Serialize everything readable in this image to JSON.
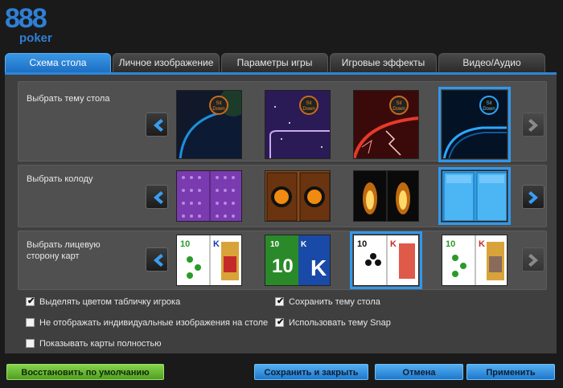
{
  "brand": {
    "logo_top": "888",
    "logo_bottom": "poker"
  },
  "tabs": [
    {
      "label": "Схема стола",
      "active": true
    },
    {
      "label": "Личное изображение",
      "active": false
    },
    {
      "label": "Параметры игры",
      "active": false
    },
    {
      "label": "Игровые эффекты",
      "active": false
    },
    {
      "label": "Видео/Аудио",
      "active": false
    }
  ],
  "sections": {
    "table_theme": {
      "label": "Выбрать тему стола",
      "sit_down": "Sit Down",
      "selected_index": 3,
      "left_arrow_icon": "chevron-left-icon",
      "right_arrow_icon": "chevron-right-icon",
      "right_arrow_enabled": false
    },
    "deck": {
      "label": "Выбрать колоду",
      "selected_index": 3,
      "right_arrow_enabled": true
    },
    "card_face": {
      "label_line1": "Выбрать лицевую",
      "label_line2": "сторону карт",
      "selected_index": 2,
      "right_arrow_enabled": false,
      "card_ten": "10",
      "card_king": "K"
    }
  },
  "options": [
    {
      "label": "Выделять цветом табличку игрока",
      "checked": true
    },
    {
      "label": "Не отображать индивидуальные изображения на столе",
      "checked": false
    },
    {
      "label": "Показывать карты полностью",
      "checked": false
    },
    {
      "label": "Сохранить тему стола",
      "checked": true
    },
    {
      "label": "Использовать тему Snap",
      "checked": true
    }
  ],
  "buttons": {
    "restore": "Восстановить по умолчанию",
    "save_close": "Сохранить и закрыть",
    "cancel": "Отмена",
    "apply": "Применить"
  },
  "colors": {
    "accent": "#2f98ef",
    "restore_button": "#5aae2e",
    "action_button": "#2c86d6"
  }
}
